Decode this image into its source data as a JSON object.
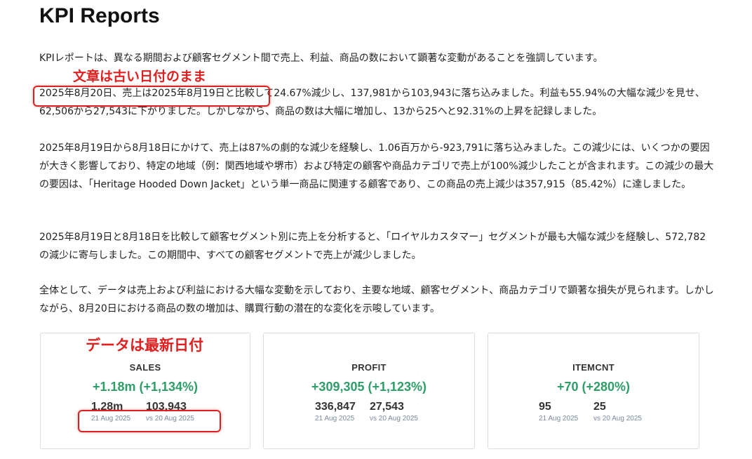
{
  "page": {
    "title": "KPI Reports"
  },
  "paragraphs": [
    "KPIレポートは、異なる期間および顧客セグメント間で売上、利益、商品の数において顕著な変動があることを強調しています。",
    "2025年8月20日、売上は2025年8月19日と比較して24.67%減少し、137,981から103,943に落ち込みました。利益も55.94%の大幅な減少を見せ、62,506から27,543に下がりました。しかしながら、商品の数は大幅に増加し、13から25へと92.31%の上昇を記録しました。",
    "2025年8月19日から8月18日にかけて、売上は87%の劇的な減少を経験し、1.06百万から-923,791に落ち込みました。この減少には、いくつかの要因が大きく影響しており、特定の地域（例：関西地域や堺市）および特定の顧客や商品カテゴリで売上が100%減少したことが含まれます。この減少の最大の要因は、「Heritage Hooded Down Jacket」という単一商品に関連する顧客であり、この商品の売上減少は357,915（85.42%）に達しました。",
    "2025年8月19日と8月18日を比較して顧客セグメント別に売上を分析すると、「ロイヤルカスタマー」セグメントが最も大幅な減少を経験し、572,782の減少に寄与しました。この期間中、すべての顧客セグメントで売上が減少しました。",
    "全体として、データは売上および利益における大幅な変動を示しており、主要な地域、顧客セグメント、商品カテゴリで顕著な損失が見られます。しかしながら、8月20日における商品の数の増加は、購買行動の潜在的な変化を示唆しています。"
  ],
  "annotations": {
    "text_note": "文章は古い日付のまま",
    "data_note": "データは最新日付"
  },
  "cards": [
    {
      "metric": "SALES",
      "change": "+1.18m (+1,134%)",
      "current": "1.28m",
      "current_date": "21 Aug 2025",
      "previous": "103,943",
      "previous_date": "vs 20 Aug 2025"
    },
    {
      "metric": "PROFIT",
      "change": "+309,305 (+1,123%)",
      "current": "336,847",
      "current_date": "21 Aug 2025",
      "previous": "27,543",
      "previous_date": "vs 20 Aug 2025"
    },
    {
      "metric": "ITEMCNT",
      "change": "+70 (+280%)",
      "current": "95",
      "current_date": "21 Aug 2025",
      "previous": "25",
      "previous_date": "vs 20 Aug 2025"
    }
  ],
  "colors": {
    "positive": "#2e9e68",
    "annotation": "#e02020",
    "muted": "#7a8aa0"
  }
}
